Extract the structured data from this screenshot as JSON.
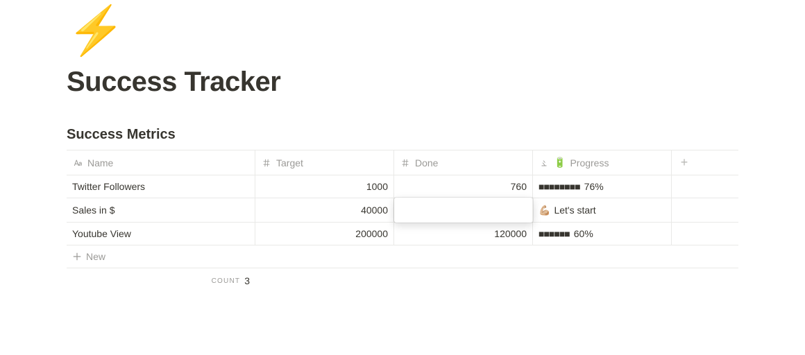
{
  "page": {
    "icon": "⚡",
    "title": "Success Tracker",
    "subtitle": "Success Metrics"
  },
  "columns": {
    "name": "Name",
    "target": "Target",
    "done": "Done",
    "progress": "Progress",
    "progress_icon": "🔋"
  },
  "rows": [
    {
      "name": "Twitter Followers",
      "target": "1000",
      "done": "760",
      "progress_bar": "■■■■■■■■",
      "progress_text": "76%"
    },
    {
      "name": "Sales in $",
      "target": "40000",
      "done": "",
      "progress_bar": "💪🏼",
      "progress_text": "Let's start"
    },
    {
      "name": "Youtube View",
      "target": "200000",
      "done": "120000",
      "progress_bar": "■■■■■■",
      "progress_text": "60%"
    }
  ],
  "new_row_label": "New",
  "footer": {
    "count_label": "COUNT",
    "count_value": "3"
  }
}
